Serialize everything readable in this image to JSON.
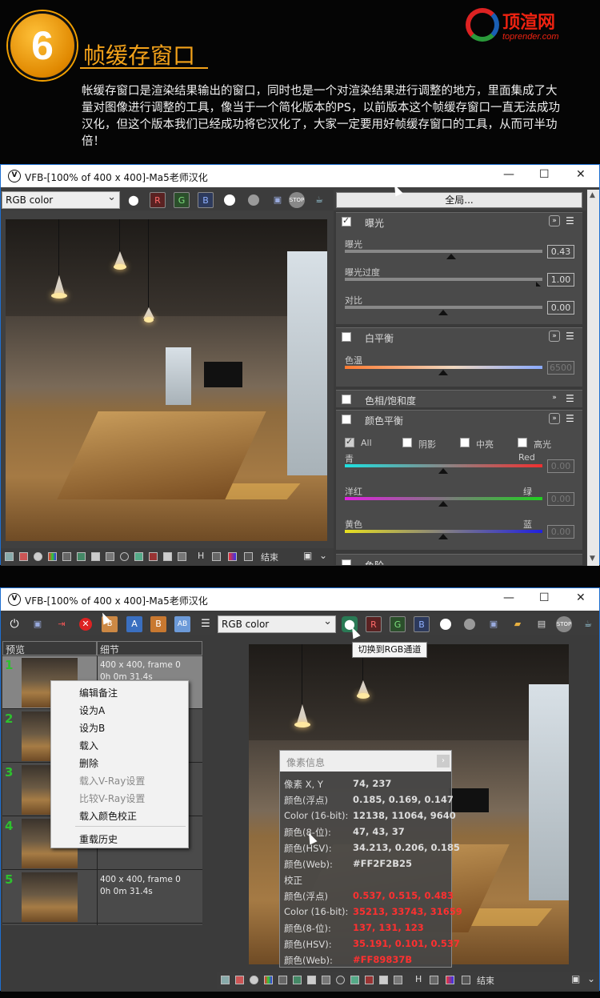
{
  "header": {
    "step_number": "6",
    "title": "帧缓存窗口",
    "description": "帐缓存窗口是渲染结果输出的窗口，同时也是一个对渲染结果进行调整的地方，里面集成了大量对图像进行调整的工具，像当于一个简化版本的PS，以前版本这个帧缓存窗口一直无法成功汉化，但这个版本我们已经成功将它汉化了，大家一定要用好帧缓存窗口的工具，从而可半功倍！",
    "logo_name": "顶渲网",
    "logo_url": "toprender.com"
  },
  "window1": {
    "title": "VFB-[100% of 400 x 400]-Ma5老师汉化",
    "channel_select": "RGB color",
    "ch_r": "R",
    "ch_g": "G",
    "ch_b": "B",
    "global_button": "全局...",
    "bottom_end": "结束",
    "bottom_h": "H",
    "exposure": {
      "title": "曝光",
      "exposure_label": "曝光",
      "exposure_value": "0.43",
      "highlight_label": "曝光过度",
      "highlight_value": "1.00",
      "contrast_label": "对比",
      "contrast_value": "0.00"
    },
    "white_balance": {
      "title": "白平衡",
      "temp_label": "色温",
      "temp_value": "6500"
    },
    "hue_sat": {
      "title": "色相/饱和度"
    },
    "color_balance": {
      "title": "颜色平衡",
      "all": "All",
      "shadows": "阴影",
      "midtones": "中亮",
      "highlights": "高光",
      "cyan": "青",
      "red": "Red",
      "cr_value": "0.00",
      "magenta": "洋红",
      "green": "绿",
      "mg_value": "0.00",
      "yellow": "黄色",
      "blue": "蓝",
      "yb_value": "0.00"
    },
    "levels": {
      "title": "色阶"
    }
  },
  "window2": {
    "title": "VFB-[100% of 400 x 400]-Ma5老师汉化",
    "channel_select": "RGB color",
    "ch_r": "R",
    "ch_g": "G",
    "ch_b": "B",
    "btn_a": "A",
    "btn_b": "B",
    "tooltip": "切换到RGB通道",
    "history": {
      "col_preview": "预览",
      "col_detail": "细节",
      "rows": [
        {
          "num": "1",
          "line1": "400 x 400, frame 0",
          "line2": "0h 0m 31.4s"
        },
        {
          "num": "2",
          "line1": "",
          "line2": ""
        },
        {
          "num": "3",
          "line1": "",
          "line2": ""
        },
        {
          "num": "4",
          "line1": "",
          "line2": ""
        },
        {
          "num": "5",
          "line1": "400 x 400, frame 0",
          "line2": "0h 0m 31.4s"
        }
      ]
    },
    "context_menu": [
      "编辑备注",
      "设为A",
      "设为B",
      "载入",
      "删除",
      "载入V-Ray设置",
      "比较V-Ray设置",
      "载入颜色校正",
      "重载历史"
    ],
    "pixel_info": {
      "title": "像素信息",
      "rows": [
        {
          "k": "像素 X, Y",
          "v": "74, 237"
        },
        {
          "k": "颜色(浮点)",
          "v": "0.185, 0.169, 0.147"
        },
        {
          "k": "Color (16-bit):",
          "v": "12138, 11064, 9640"
        },
        {
          "k": "颜色(8-位):",
          "v": "47, 43, 37"
        },
        {
          "k": "颜色(HSV):",
          "v": "34.213, 0.206, 0.185"
        },
        {
          "k": "颜色(Web):",
          "v": "#FF2F2B25"
        },
        {
          "k": "校正",
          "v": ""
        },
        {
          "k": "颜色(浮点)",
          "v": "0.537, 0.515, 0.483"
        },
        {
          "k": "Color (16-bit):",
          "v": "35213, 33743, 31659"
        },
        {
          "k": "颜色(8-位):",
          "v": "137, 131, 123"
        },
        {
          "k": "颜色(HSV):",
          "v": "35.191, 0.101, 0.537"
        },
        {
          "k": "颜色(Web):",
          "v": "#FF89837B"
        }
      ]
    },
    "bottom_end": "结束",
    "bottom_h": "H"
  },
  "colors": {
    "accent_orange": "#f3a21a",
    "window_border": "#1e6fd0",
    "corrected_red": "#ff3030",
    "history_number_green": "#2ec12e"
  }
}
